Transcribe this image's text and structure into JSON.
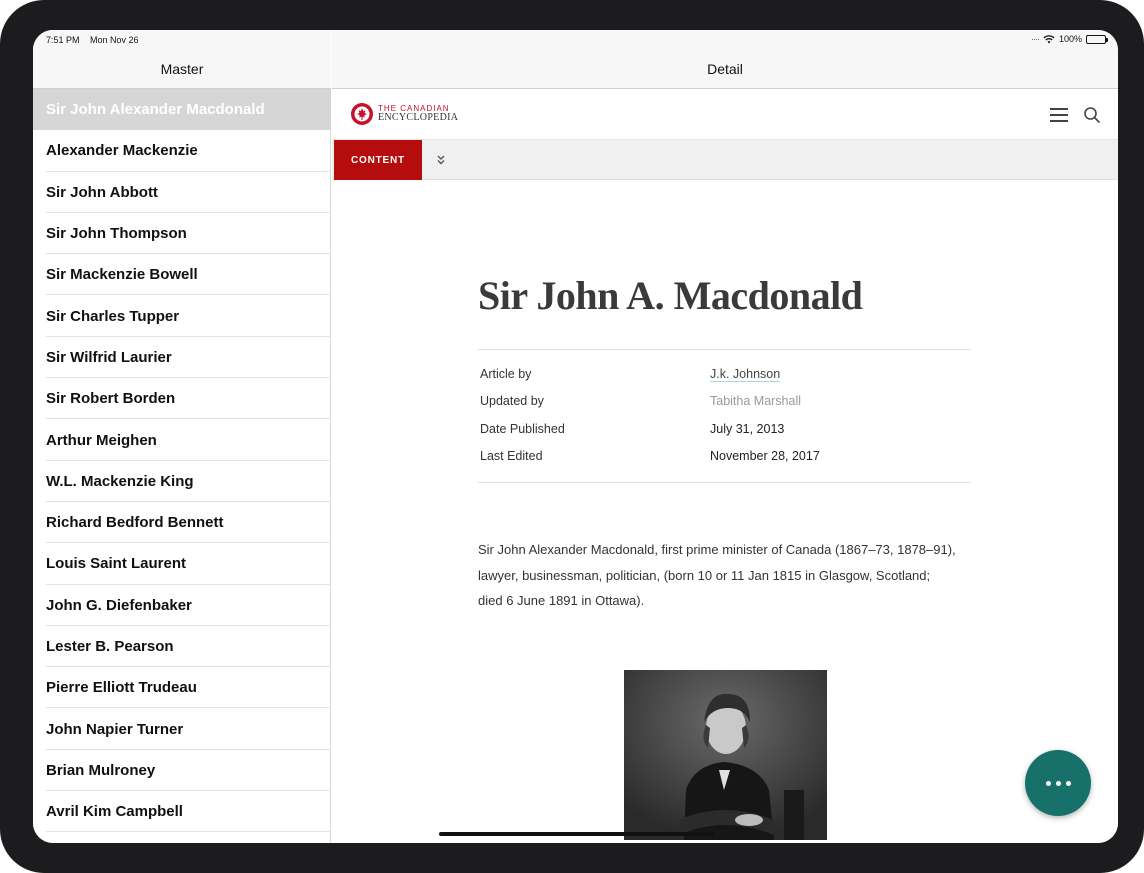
{
  "status_bar": {
    "time": "7:51 PM",
    "date": "Mon Nov 26",
    "battery": "100%"
  },
  "master": {
    "title": "Master",
    "selected_index": 0,
    "items": [
      "Sir John Alexander Macdonald",
      "Alexander Mackenzie",
      "Sir John Abbott",
      "Sir John Thompson",
      "Sir Mackenzie Bowell",
      "Sir Charles Tupper",
      "Sir Wilfrid Laurier",
      "Sir Robert Borden",
      "Arthur Meighen",
      "W.L. Mackenzie King",
      "Richard Bedford Bennett",
      "Louis Saint Laurent",
      "John G. Diefenbaker",
      "Lester B. Pearson",
      "Pierre Elliott Trudeau",
      "John Napier Turner",
      "Brian Mulroney",
      "Avril Kim Campbell"
    ]
  },
  "detail": {
    "title": "Detail",
    "logo": {
      "line1": "THE CANADIAN",
      "line2": "ENCYCLOPEDIA"
    },
    "tab_label": "CONTENT",
    "article": {
      "title": "Sir John A. Macdonald",
      "meta": [
        {
          "label": "Article by",
          "value": "J.k. Johnson"
        },
        {
          "label": "Updated by",
          "value": "Tabitha Marshall"
        },
        {
          "label": "Date Published",
          "value": "July 31, 2013"
        },
        {
          "label": "Last Edited",
          "value": "November 28, 2017"
        }
      ],
      "intro": "Sir John Alexander Macdonald, first prime minister of Canada (1867–73, 1878–91), lawyer, businessman, politician, (born 10 or 11 Jan 1815 in Glasgow, Scotland; died 6 June 1891 in Ottawa)."
    }
  },
  "colors": {
    "brand_red": "#b50d0d",
    "fab_teal": "#17706a"
  }
}
